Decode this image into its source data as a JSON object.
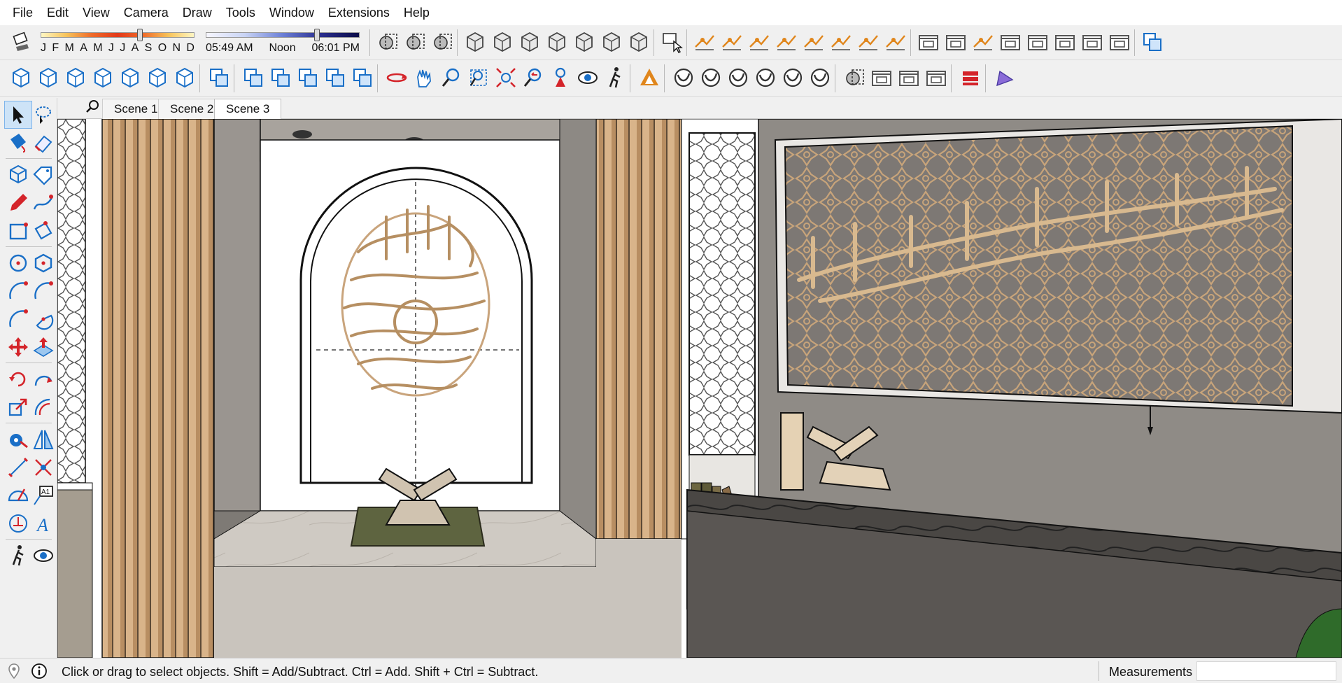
{
  "menu": [
    "File",
    "Edit",
    "View",
    "Camera",
    "Draw",
    "Tools",
    "Window",
    "Extensions",
    "Help"
  ],
  "shadow": {
    "months": [
      "J",
      "F",
      "M",
      "A",
      "M",
      "J",
      "J",
      "A",
      "S",
      "O",
      "N",
      "D"
    ],
    "month_position": 0.65,
    "time_start": "05:49 AM",
    "time_mid": "Noon",
    "time_end": "06:01 PM",
    "time_position": 0.73
  },
  "toolbar_row1_icons": [
    "section-plane-icon",
    "display-section-planes-icon",
    "display-section-cuts-icon",
    "xray-icon",
    "back-edges-icon",
    "wireframe-icon",
    "hidden-line-icon",
    "shaded-icon",
    "shaded-with-textures-icon",
    "monochrome-icon",
    "interact-icon",
    "sandbox-from-contours-icon",
    "sandbox-from-scratch-icon",
    "smoove-icon",
    "stamp-icon",
    "drape-icon",
    "add-detail-icon",
    "flip-edge-icon",
    "hide-edges-icon",
    "orient-faces-icon",
    "add-location-icon",
    "toggle-terrain-icon",
    "photo-textures-icon",
    "preview-in-earth-icon",
    "get-models-icon",
    "share-model-icon",
    "warehouse-icon",
    "outer-shell-icon"
  ],
  "toolbar_row2_icons": [
    "iso-view-icon",
    "top-view-icon",
    "front-view-icon",
    "right-view-icon",
    "back-view-icon",
    "left-view-icon",
    "bottom-view-icon",
    "outer-shell-tool-icon",
    "intersect-icon",
    "union-icon",
    "subtract-icon",
    "trim-icon",
    "split-icon",
    "orbit-icon",
    "pan-icon",
    "zoom-icon",
    "zoom-window-icon",
    "zoom-extents-icon",
    "previous-view-icon",
    "position-camera-icon",
    "look-around-icon",
    "walk-icon",
    "layout-icon",
    "style-builder-icon",
    "styles-icon",
    "extension-warehouse-icon",
    "extension-manager-icon",
    "soften-icon",
    "rotate-3d-icon",
    "section-display-icon",
    "camera-match-icon",
    "photo-match-icon",
    "lock-icon",
    "ruby-console-icon",
    "profile-icon"
  ],
  "left_tools": [
    "select-icon",
    "lasso-icon",
    "paint-bucket-icon",
    "eraser-icon",
    "make-component-icon",
    "tag-icon",
    "pencil-icon",
    "freehand-icon",
    "rectangle-icon",
    "rotated-rectangle-icon",
    "circle-icon",
    "polygon-icon",
    "arc-icon",
    "two-point-arc-icon",
    "three-point-arc-icon",
    "pie-icon",
    "move-icon",
    "push-pull-icon",
    "rotate-icon",
    "follow-me-icon",
    "scale-icon",
    "offset-icon",
    "tape-measure-icon",
    "mirror-icon",
    "dimension-icon",
    "section-icon",
    "protractor-icon",
    "text-icon",
    "axes-icon",
    "3d-text-icon",
    "walk-icon",
    "look-icon"
  ],
  "scenes": [
    {
      "label": "Scene 1",
      "active": false
    },
    {
      "label": "Scene 2",
      "active": false
    },
    {
      "label": "Scene 3",
      "active": true
    }
  ],
  "status": {
    "hint": "Click or drag to select objects. Shift = Add/Subtract. Ctrl = Add. Shift + Ctrl = Subtract.",
    "measurements_label": "Measurements",
    "measurements_value": ""
  },
  "colors": {
    "wood": "#cfa87a",
    "wall_grey": "#8f8b86",
    "arch_white": "#ffffff",
    "floor": "#c9c4bd",
    "bench": "#3a3836"
  }
}
